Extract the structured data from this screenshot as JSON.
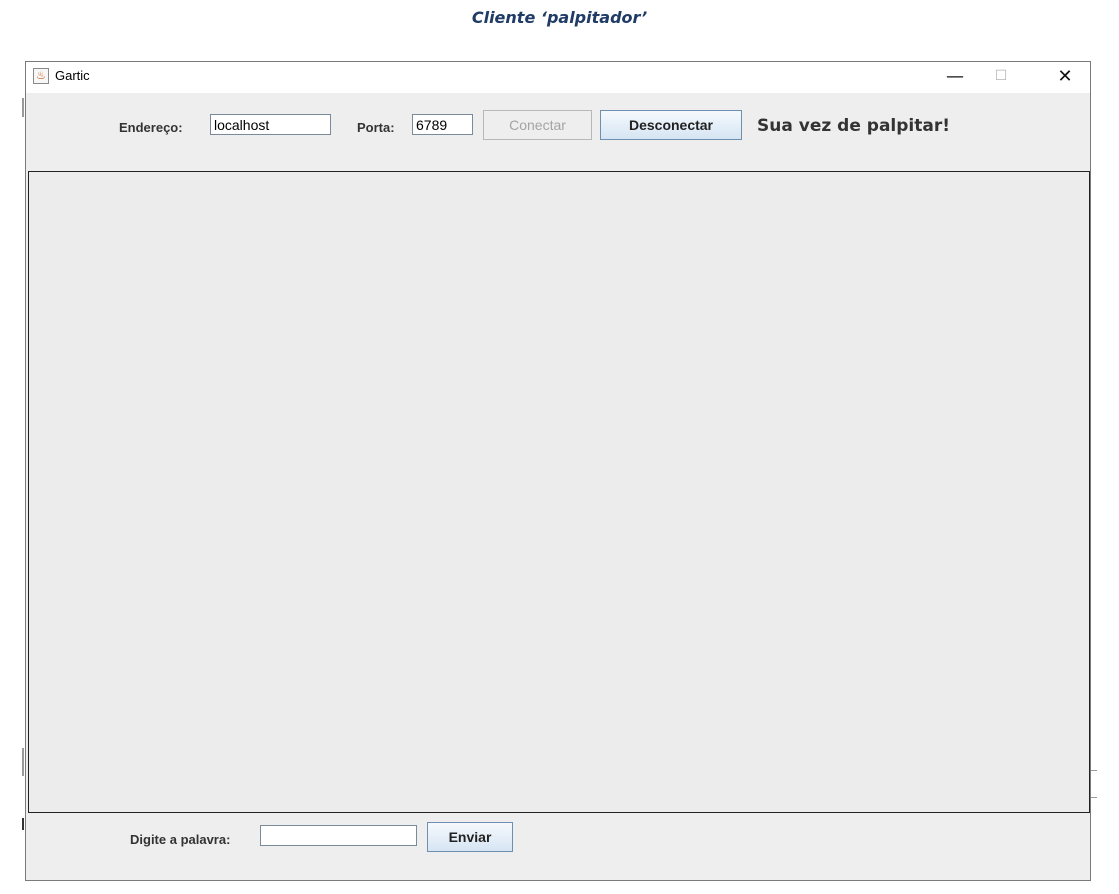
{
  "caption": "Cliente ‘palpitador’",
  "window": {
    "title": "Gartic",
    "icon": "java-icon",
    "controls": {
      "minimize": "—",
      "maximize": "☐",
      "close": "✕"
    }
  },
  "connection": {
    "address_label": "Endereço:",
    "address_value": "localhost",
    "port_label": "Porta:",
    "port_value": "6789",
    "connect_label": "Conectar",
    "disconnect_label": "Desconectar",
    "status_text": "Sua vez de palpitar!"
  },
  "bottom": {
    "word_label": "Digite a palavra:",
    "word_value": "",
    "send_label": "Enviar"
  }
}
